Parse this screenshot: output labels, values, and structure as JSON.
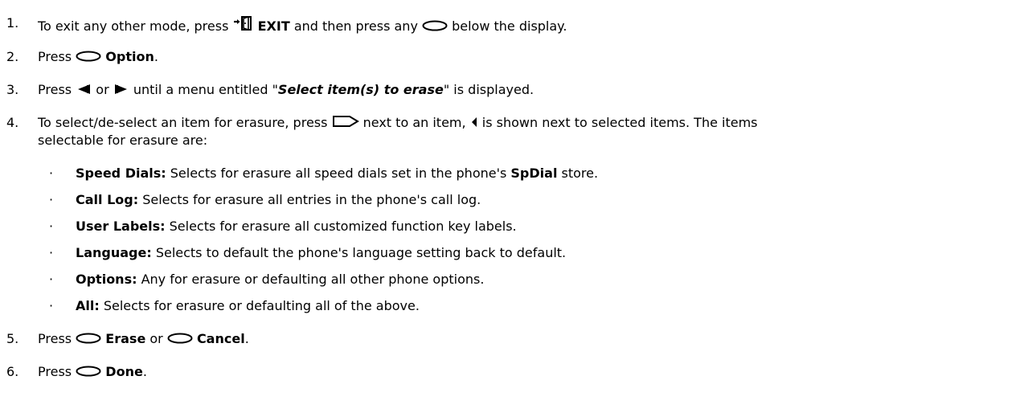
{
  "steps": [
    {
      "num": "1.",
      "t1": "To exit any other mode, press ",
      "exit_label": "EXIT",
      "t2": " and then press any ",
      "t3": " below the display.",
      "icons": [
        "exit-icon",
        "soft-key-icon"
      ]
    },
    {
      "num": "2.",
      "t1": "Press ",
      "key_label": "Option",
      "t2": ".",
      "icons": [
        "soft-key-icon"
      ]
    },
    {
      "num": "3.",
      "t1": "Press ",
      "t2": " or ",
      "t3": " until a menu entitled \"",
      "menu_title": "Select item(s) to erase",
      "t4": "\" is displayed.",
      "icons": [
        "left-scroll-icon",
        "right-scroll-icon"
      ]
    },
    {
      "num": "4.",
      "t1": "To select/de-select an item for erasure, press ",
      "t2": " next to an item, ",
      "t3": " is shown next to selected items. The items",
      "t4": "selectable for erasure are:",
      "icons": [
        "display-key-icon",
        "selected-marker-icon"
      ]
    },
    {
      "num": "5.",
      "t1": "Press ",
      "erase_label": "Erase",
      "t2": " or ",
      "cancel_label": "Cancel",
      "t3": ".",
      "icons": [
        "soft-key-icon",
        "soft-key-icon"
      ]
    },
    {
      "num": "6.",
      "t1": "Press ",
      "done_label": "Done",
      "t2": ".",
      "icons": [
        "soft-key-icon"
      ]
    }
  ],
  "bullet_char": "·",
  "items": [
    {
      "label": "Speed Dials:",
      "text_pre": " Selects for erasure all speed dials set in the phone's ",
      "store": "SpDial",
      "text_post": " store."
    },
    {
      "label": "Call Log:",
      "text": " Selects for erasure all entries in the phone's call log."
    },
    {
      "label": "User Labels:",
      "text": " Selects for erasure all customized function key labels."
    },
    {
      "label": "Language:",
      "text": " Selects to default the phone's language setting back to default."
    },
    {
      "label": "Options:",
      "text": " Any for erasure or defaulting all other phone options."
    },
    {
      "label": "All:",
      "text": " Selects for erasure or defaulting all of the above."
    }
  ]
}
